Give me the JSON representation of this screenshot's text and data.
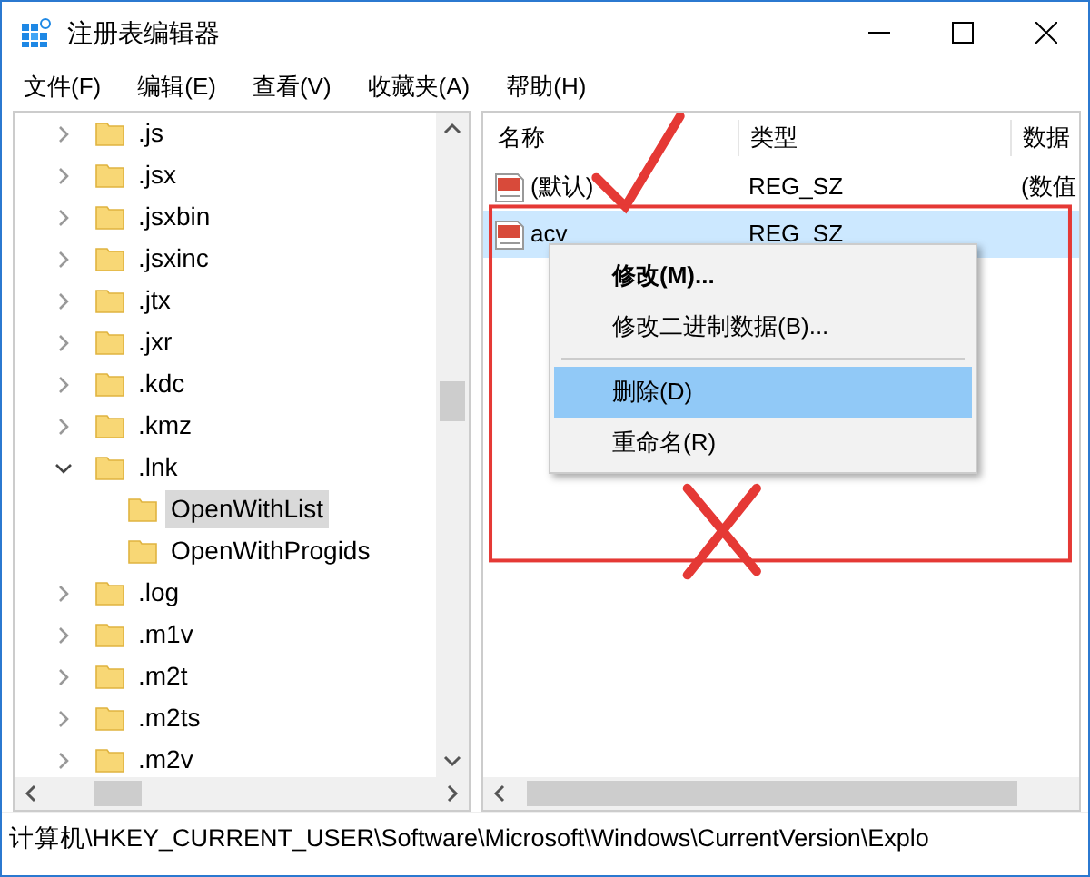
{
  "window": {
    "title": "注册表编辑器"
  },
  "menu": [
    "文件(F)",
    "编辑(E)",
    "查看(V)",
    "收藏夹(A)",
    "帮助(H)"
  ],
  "tree": {
    "items": [
      {
        "label": ".js",
        "expanded": false,
        "selected": false
      },
      {
        "label": ".jsx",
        "expanded": false,
        "selected": false
      },
      {
        "label": ".jsxbin",
        "expanded": false,
        "selected": false
      },
      {
        "label": ".jsxinc",
        "expanded": false,
        "selected": false
      },
      {
        "label": ".jtx",
        "expanded": false,
        "selected": false
      },
      {
        "label": ".jxr",
        "expanded": false,
        "selected": false
      },
      {
        "label": ".kdc",
        "expanded": false,
        "selected": false
      },
      {
        "label": ".kmz",
        "expanded": false,
        "selected": false
      },
      {
        "label": ".lnk",
        "expanded": true,
        "selected": false,
        "children": [
          {
            "label": "OpenWithList",
            "selected": true
          },
          {
            "label": "OpenWithProgids",
            "selected": false
          }
        ]
      },
      {
        "label": ".log",
        "expanded": false,
        "selected": false
      },
      {
        "label": ".m1v",
        "expanded": false,
        "selected": false
      },
      {
        "label": ".m2t",
        "expanded": false,
        "selected": false
      },
      {
        "label": ".m2ts",
        "expanded": false,
        "selected": false
      },
      {
        "label": ".m2v",
        "expanded": false,
        "selected": false
      }
    ]
  },
  "values": {
    "columns": [
      "名称",
      "类型",
      "数据"
    ],
    "rows": [
      {
        "name": "(默认)",
        "type": "REG_SZ",
        "data": "(数值",
        "selected": false
      },
      {
        "name": "acv",
        "type": "REG_SZ",
        "selected": true
      }
    ]
  },
  "context_menu": {
    "items": [
      {
        "kind": "item",
        "label": "修改(M)...",
        "default": true,
        "selected": false
      },
      {
        "kind": "item",
        "label": "修改二进制数据(B)...",
        "default": false,
        "selected": false
      },
      {
        "kind": "separator"
      },
      {
        "kind": "item",
        "label": "删除(D)",
        "default": false,
        "selected": true
      },
      {
        "kind": "item",
        "label": "重命名(R)",
        "default": false,
        "selected": false
      }
    ]
  },
  "annotations": [
    {
      "kind": "check"
    },
    {
      "kind": "frame"
    },
    {
      "kind": "cross"
    }
  ],
  "status_bar": "计算机\\HKEY_CURRENT_USER\\Software\\Microsoft\\Windows\\CurrentVersion\\Explo"
}
